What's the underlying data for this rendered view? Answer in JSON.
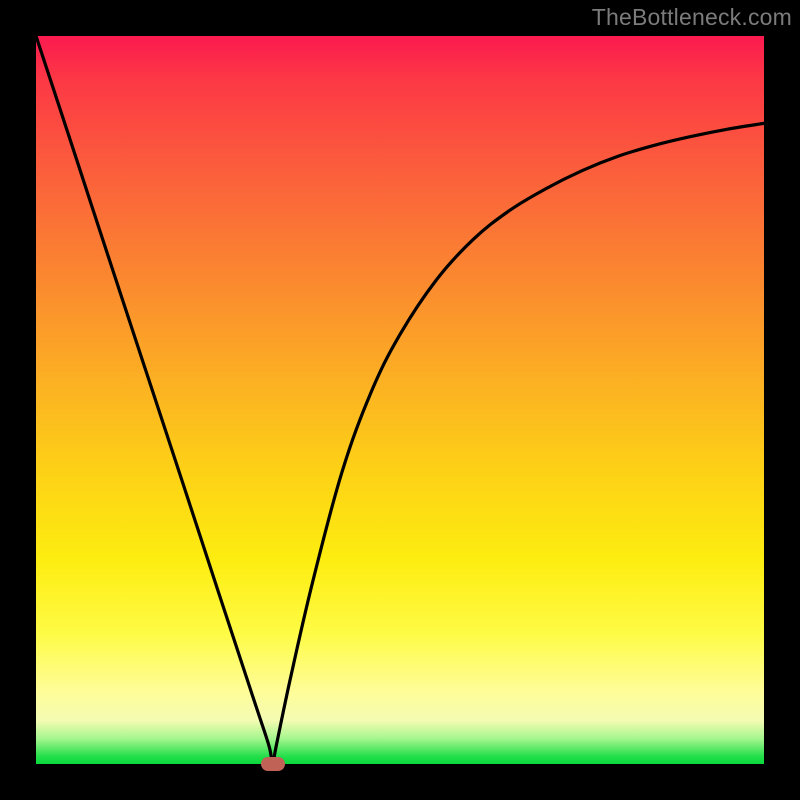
{
  "domain": "Chart",
  "watermark": "TheBottleneck.com",
  "chart_data": {
    "type": "line",
    "title": "",
    "xlabel": "",
    "ylabel": "",
    "xlim": [
      0,
      1
    ],
    "ylim": [
      0,
      1
    ],
    "x": [
      0.0,
      0.05,
      0.1,
      0.15,
      0.2,
      0.25,
      0.3,
      0.32,
      0.325,
      0.33,
      0.35,
      0.38,
      0.42,
      0.46,
      0.5,
      0.55,
      0.6,
      0.65,
      0.7,
      0.75,
      0.8,
      0.85,
      0.9,
      0.95,
      1.0
    ],
    "y": [
      1.0,
      0.848,
      0.695,
      0.543,
      0.391,
      0.238,
      0.086,
      0.025,
      0.0,
      0.025,
      0.12,
      0.25,
      0.4,
      0.51,
      0.59,
      0.665,
      0.72,
      0.76,
      0.79,
      0.815,
      0.835,
      0.85,
      0.862,
      0.872,
      0.88
    ],
    "min_point": {
      "x": 0.325,
      "y": 0.0
    },
    "annotations": []
  },
  "colors": {
    "background": "#000000",
    "curve": "#000000",
    "marker": "#c16257",
    "watermark": "#7b7b7b"
  }
}
